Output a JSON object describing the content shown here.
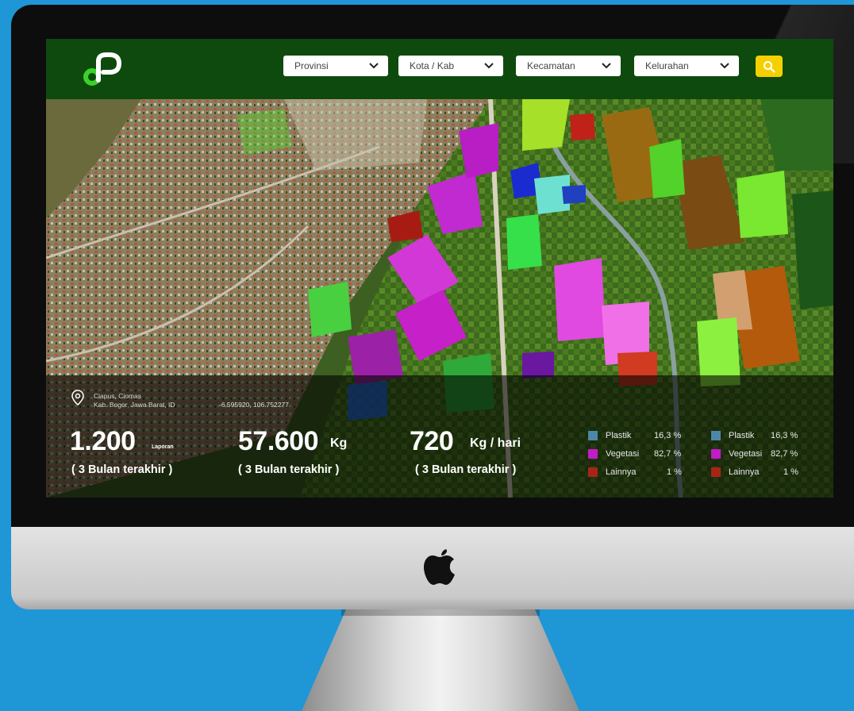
{
  "header": {
    "filters": [
      {
        "label": "Provinsi"
      },
      {
        "label": "Kota / Kab"
      },
      {
        "label": "Kecamatan"
      },
      {
        "label": "Kelurahan"
      }
    ]
  },
  "location": {
    "place": "Ciapus, Ciomas",
    "region": "Kab. Bogor, Jawa Barat, ID",
    "coordinates": "-6.595920, 106.752277"
  },
  "stats": [
    {
      "value": "1.200",
      "unit": "Laporan",
      "period": "( 3 Bulan terakhir )"
    },
    {
      "value": "57.600",
      "unit": "Kg",
      "period": "( 3 Bulan terakhir )"
    },
    {
      "value": "720",
      "unit": "Kg / hari",
      "period": "( 3 Bulan terakhir )"
    }
  ],
  "legend_left": [
    {
      "label": "Plastik",
      "percent": "16,3 %",
      "color": "#4e86a8"
    },
    {
      "label": "Vegetasi",
      "percent": "82,7 %",
      "color": "#c21cc8"
    },
    {
      "label": "Lainnya",
      "percent": "1 %",
      "color": "#a82516"
    }
  ],
  "legend_right": [
    {
      "label": "Plastik",
      "percent": "16,3 %",
      "color": "#4e86a8"
    },
    {
      "label": "Vegetasi",
      "percent": "82,7 %",
      "color": "#c21cc8"
    },
    {
      "label": "Lainnya",
      "percent": "1 %",
      "color": "#a82516"
    }
  ],
  "colors": {
    "topbar": "#0e4a0d",
    "brand": "#3ad12a",
    "search": "#f5d000",
    "background": "#1f96d6"
  },
  "icons": [
    "brand-logo",
    "chevron-down-icon",
    "search-icon",
    "location-pin-icon",
    "apple-logo"
  ]
}
